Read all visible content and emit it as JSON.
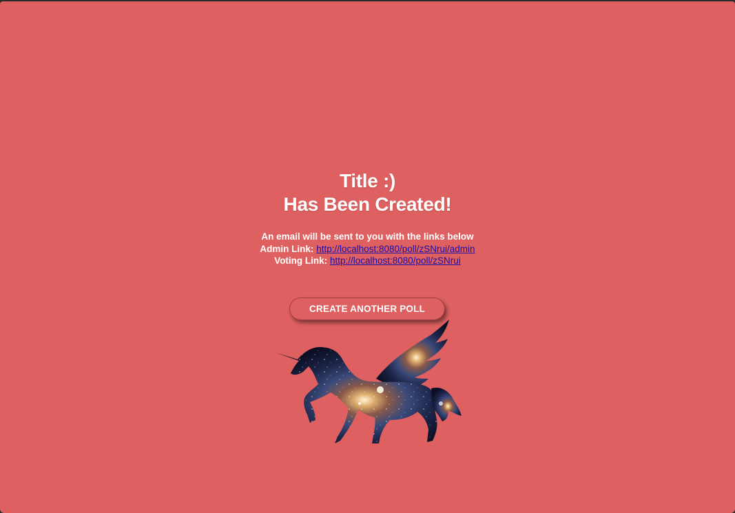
{
  "page": {
    "background_color": "#df6060",
    "link_color": "#1a0dab"
  },
  "heading": {
    "title": "Title :)",
    "subtitle": "Has Been Created!"
  },
  "info": {
    "email_notice": "An email will be sent to you with the links below",
    "admin_label": "Admin Link:",
    "admin_url": "http://localhost:8080/poll/zSNrui/admin",
    "voting_label": "Voting Link:",
    "voting_url": "http://localhost:8080/poll/zSNrui"
  },
  "actions": {
    "create_another_label": "CREATE ANOTHER POLL"
  },
  "image": {
    "icon": "unicorn-galaxy-icon"
  }
}
